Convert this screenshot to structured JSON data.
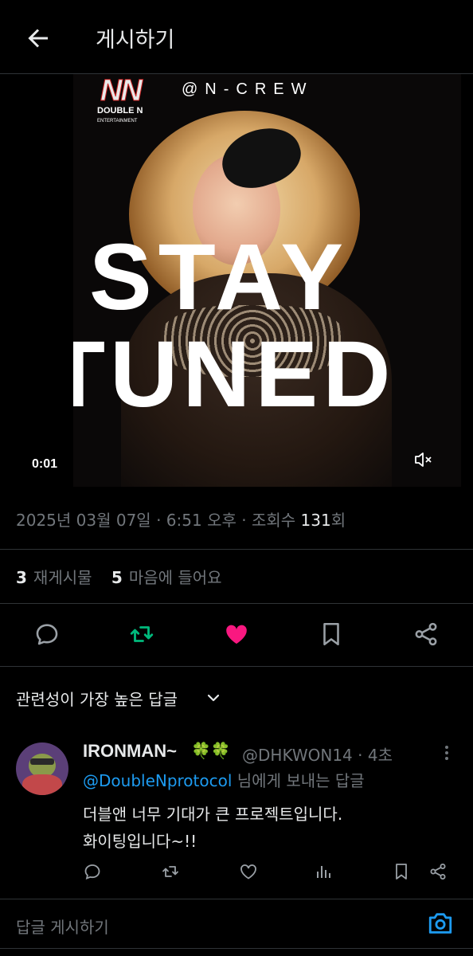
{
  "header": {
    "title": "게시하기"
  },
  "media": {
    "logo_mark": "NN",
    "logo_line1": "DOUBLE N",
    "logo_line2": "ENTERTAINMENT",
    "handle_tag": "@N-CREW",
    "headline_1": "STAY",
    "headline_2": "TUNED",
    "time_code": "0:01"
  },
  "meta": {
    "date": "2025년 03월 07일",
    "sep": " · ",
    "time": "6:51 오후",
    "views_label": "조회수 ",
    "views": "131",
    "views_suffix": "회"
  },
  "stats": {
    "reposts": "3",
    "reposts_label": "재게시물",
    "likes": "5",
    "likes_label": "마음에 들어요"
  },
  "sort": {
    "label": "관련성이 가장 높은 답글"
  },
  "reply": {
    "name": "IRONMAN~",
    "clover": "🍀🍀",
    "handle_time": "@DHKWON14 · 4초",
    "to_handle": "@DoubleNprotocol",
    "to_suffix": " 님에게 보내는 답글",
    "body_line1": "더블앤 너무 기대가 큰 프로젝트입니다.",
    "body_line2": "화이팅입니다~!!"
  },
  "compose": {
    "placeholder": "답글 게시하기"
  },
  "colors": {
    "accent": "#1d9bf0",
    "repost": "#00ba7c",
    "like": "#f91880"
  }
}
